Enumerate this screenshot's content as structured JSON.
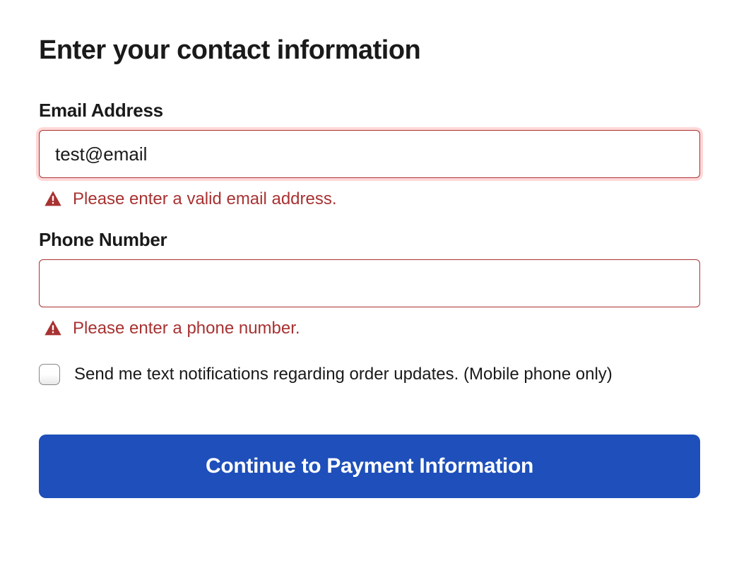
{
  "title": "Enter your contact information",
  "email": {
    "label": "Email Address",
    "value": "test@email",
    "error": "Please enter a valid email address."
  },
  "phone": {
    "label": "Phone Number",
    "value": "",
    "error": "Please enter a phone number."
  },
  "sms_optin": {
    "label": "Send me text notifications regarding order updates. (Mobile phone only)",
    "checked": false
  },
  "submit": {
    "label": "Continue to Payment Information"
  },
  "colors": {
    "error": "#a83232",
    "primary": "#1e4fba"
  }
}
